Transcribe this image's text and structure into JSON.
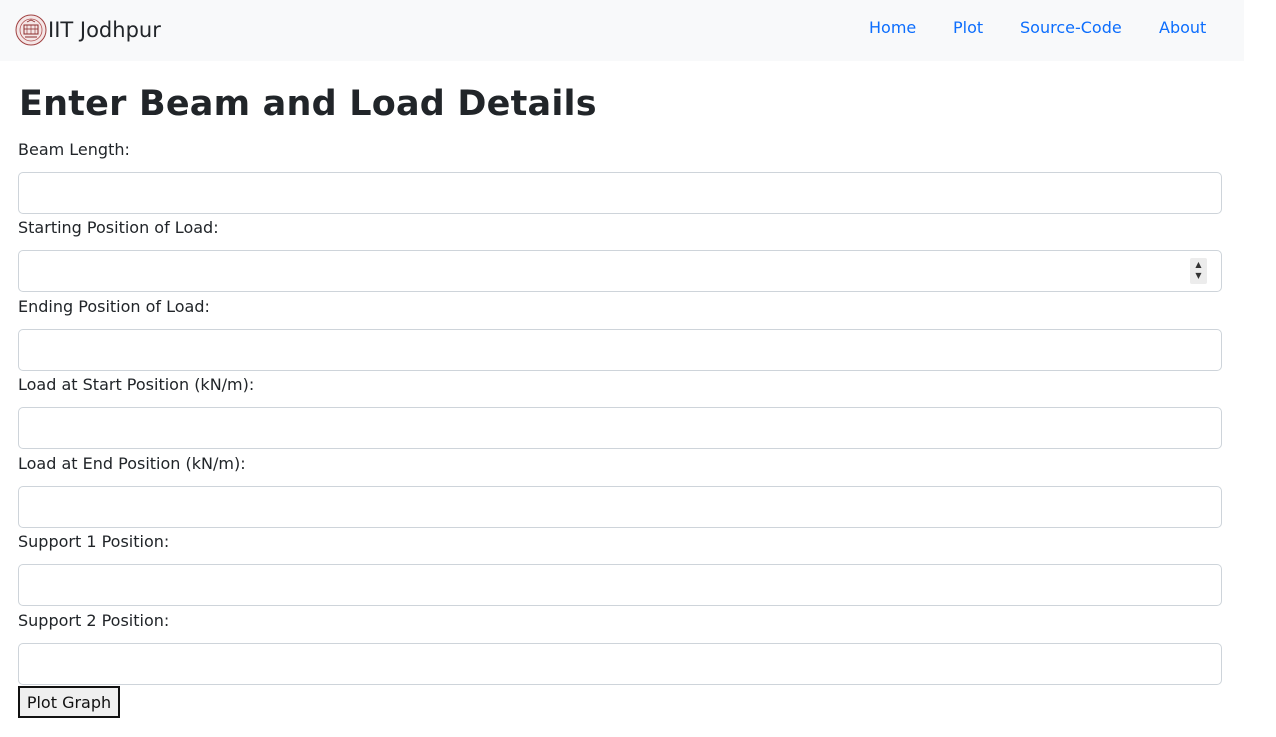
{
  "navbar": {
    "brand": "IIT Jodhpur",
    "links": [
      "Home",
      "Plot",
      "Source-Code",
      "About"
    ],
    "link_color": "#0d6efd",
    "background": "#f8f9fa"
  },
  "form": {
    "title": "Enter Beam and Load Details",
    "fields": [
      {
        "label": "Beam Length:",
        "value": ""
      },
      {
        "label": "Starting Position of Load:",
        "value": ""
      },
      {
        "label": "Ending Position of Load:",
        "value": ""
      },
      {
        "label": "Load at Start Position (kN/m):",
        "value": ""
      },
      {
        "label": "Load at End Position (kN/m):",
        "value": ""
      },
      {
        "label": "Support 1 Position:",
        "value": ""
      },
      {
        "label": "Support 2 Position:",
        "value": ""
      }
    ],
    "submit_label": "Plot Graph"
  }
}
